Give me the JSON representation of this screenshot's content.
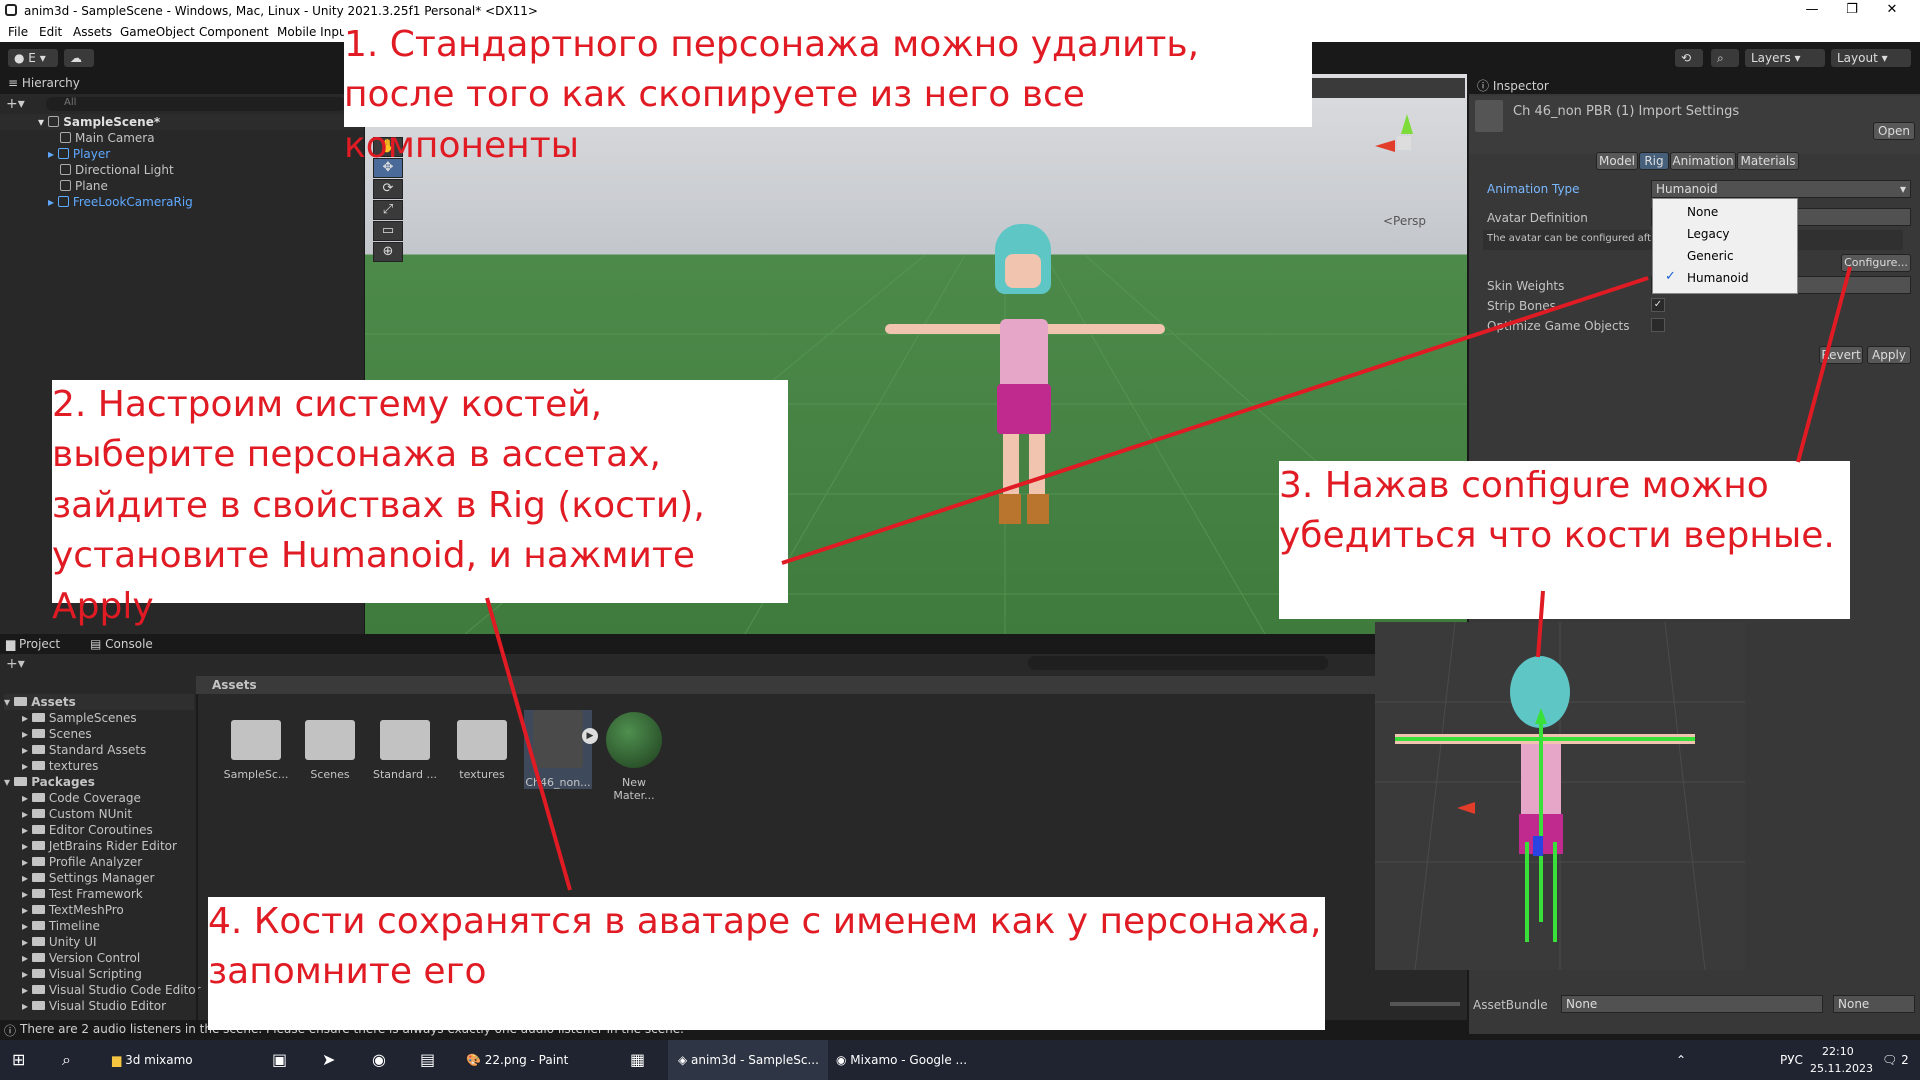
{
  "window": {
    "title": "anim3d - SampleScene - Windows, Mac, Linux - Unity 2021.3.25f1 Personal* <DX11>",
    "minimize": "—",
    "maximize": "❐",
    "close": "✕"
  },
  "menu": [
    "File",
    "Edit",
    "Assets",
    "GameObject",
    "Component",
    "Mobile Input"
  ],
  "toolbar": {
    "account": "E",
    "layers": "Layers",
    "layout": "Layout"
  },
  "hierarchy": {
    "tab": "Hierarchy",
    "search_placeholder": "All",
    "scene": "SampleScene*",
    "items": [
      "Main Camera",
      "Player",
      "Directional Light",
      "Plane",
      "FreeLookCameraRig"
    ]
  },
  "scene_view": {
    "persp": "<Persp"
  },
  "inspector": {
    "tab": "Inspector",
    "title": "Ch 46_non PBR (1) Import Settings",
    "open": "Open",
    "tabs": [
      "Model",
      "Rig",
      "Animation",
      "Materials"
    ],
    "animation_type_label": "Animation Type",
    "animation_type_value": "Humanoid",
    "avatar_definition_label": "Avatar Definition",
    "avatar_hint": "The avatar can be configured aft",
    "configure": "Configure...",
    "skin_weights_label": "Skin Weights",
    "strip_bones_label": "Strip Bones",
    "optimize_label": "Optimize Game Objects",
    "revert": "Revert",
    "apply": "Apply",
    "dropdown_options": [
      "None",
      "Legacy",
      "Generic",
      "Humanoid"
    ],
    "dropdown_selected": "Humanoid",
    "assetbundle_label": "AssetBundle",
    "assetbundle_value": "None",
    "assetbundle_variant": "None"
  },
  "project": {
    "tab_project": "Project",
    "tab_console": "Console",
    "assets_header": "Assets",
    "tree_assets": "Assets",
    "tree_asset_items": [
      "SampleScenes",
      "Scenes",
      "Standard Assets",
      "textures"
    ],
    "tree_packages": "Packages",
    "tree_package_items": [
      "Code Coverage",
      "Custom NUnit",
      "Editor Coroutines",
      "JetBrains Rider Editor",
      "Profile Analyzer",
      "Settings Manager",
      "Test Framework",
      "TextMeshPro",
      "Timeline",
      "Unity UI",
      "Version Control",
      "Visual Scripting",
      "Visual Studio Code Editor",
      "Visual Studio Editor"
    ],
    "grid_items": [
      "SampleSc...",
      "Scenes",
      "Standard ...",
      "textures",
      "Ch46_non...",
      "New Mater..."
    ]
  },
  "status_text": "There are 2 audio listeners in the scene. Please ensure there is always exactly one audio listener in the scene.",
  "taskbar": {
    "items": [
      "3d mixamo",
      "22.png - Paint",
      "anim3d - SampleSc...",
      "Mixamo - Google ..."
    ],
    "lang": "РУС",
    "time": "22:10",
    "date": "25.11.2023",
    "notif": "2"
  },
  "annotations": {
    "note1": "1. Стандартного персонажа можно удалить, после того как скопируете из него все компоненты",
    "note2": "2. Настроим систему костей, выберите персонажа в ассетах, зайдите в свойствах в Rig (кости), установите Humanoid, и нажмите Apply",
    "note3": "3. Нажав configure можно убедиться что кости верные.",
    "note4": "4. Кости сохранятся в аватаре с именем как у персонажа, запомните его"
  },
  "colors": {
    "annotation": "#e01b24",
    "accent": "#4c7fff",
    "ground": "#3f7b3d"
  }
}
